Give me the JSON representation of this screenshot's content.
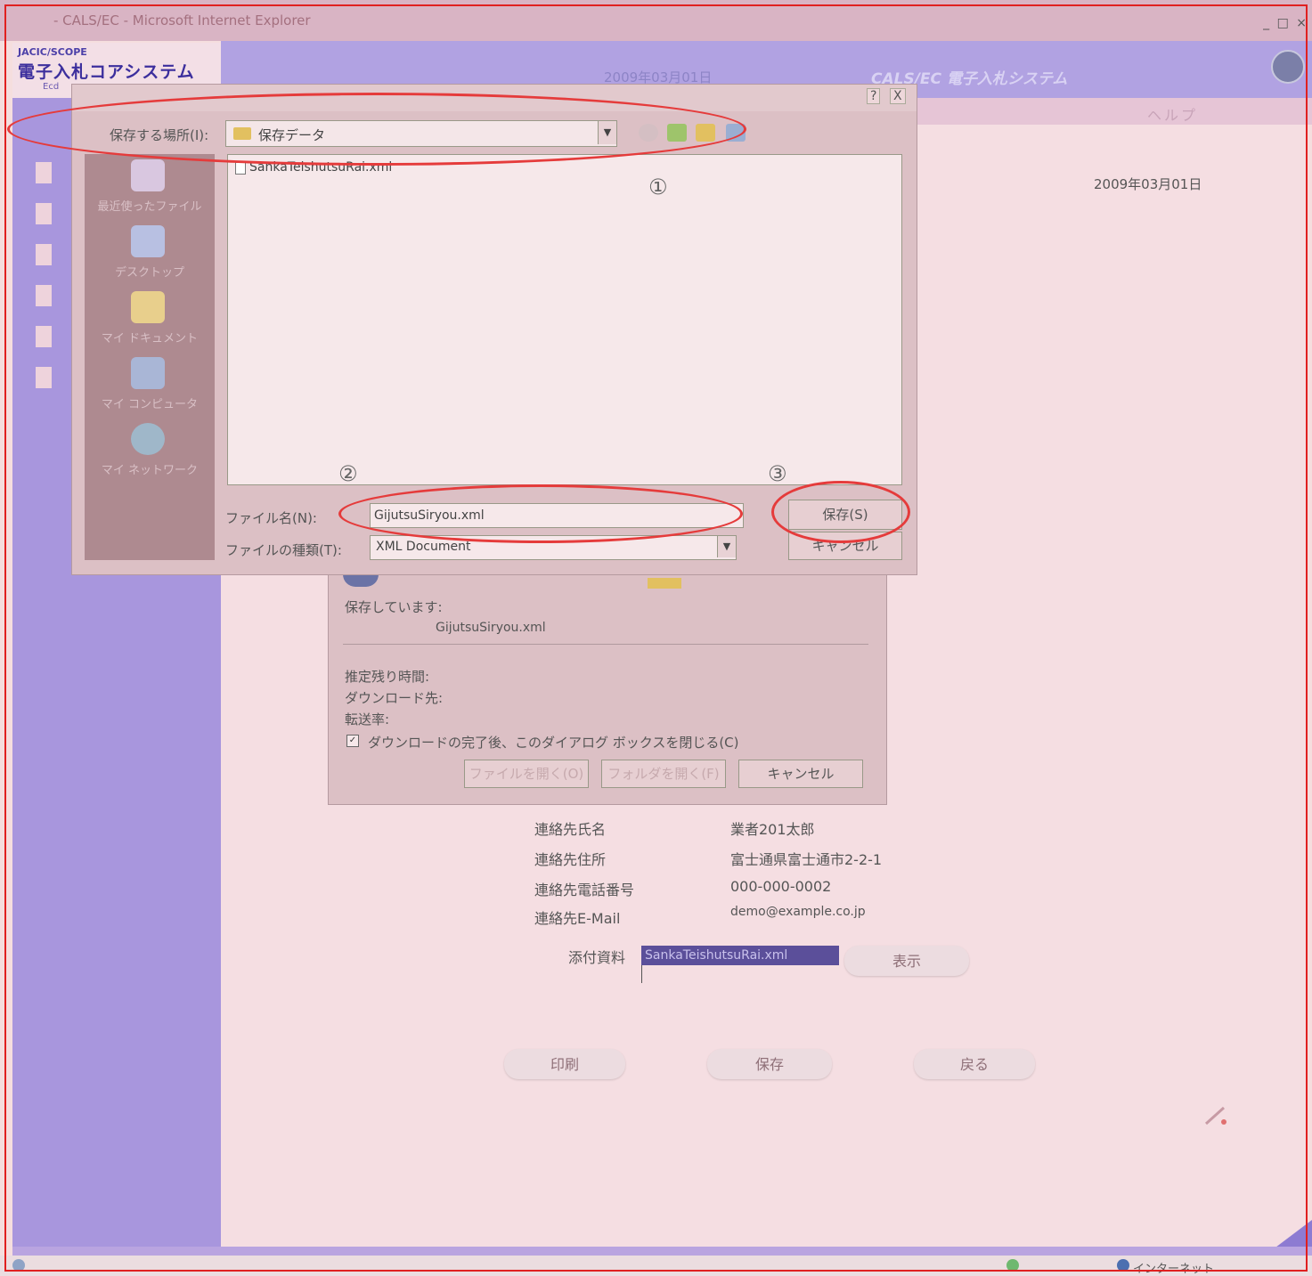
{
  "browser": {
    "title": "- CALS/EC - Microsoft Internet Explorer",
    "window_controls": "_ □ ×"
  },
  "header": {
    "logo_sub": "JACIC/SCOPE",
    "logo_main": "電子入札コアシステム",
    "logo_foot": "Ecd",
    "ghost_text": "2009年03月01日",
    "system_title": "CALS/EC 電子入札システム",
    "help": "ヘルプ"
  },
  "content": {
    "date": "2009年03月01日"
  },
  "save_dialog": {
    "help_btn": "?",
    "close_btn": "X",
    "location_label": "保存する場所(I):",
    "location_value": "保存データ",
    "places": [
      "最近使ったファイル",
      "デスクトップ",
      "マイ ドキュメント",
      "マイ コンピュータ",
      "マイ ネットワーク"
    ],
    "files": [
      "SankaTeishutsuRai.xml"
    ],
    "filename_label": "ファイル名(N):",
    "filename_value": "GijutsuSiryou.xml",
    "filetype_label": "ファイルの種類(T):",
    "filetype_value": "XML Document",
    "save_button": "保存(S)",
    "cancel_button": "キャンセル"
  },
  "annotations": {
    "step1": "①",
    "step2": "②",
    "step3": "③"
  },
  "download_dialog": {
    "saving": "保存しています:",
    "file": "GijutsuSiryou.xml",
    "remaining_label": "推定残り時間:",
    "dest_label": "ダウンロード先:",
    "rate_label": "転送率:",
    "close_checkbox": "ダウンロードの完了後、このダイアログ ボックスを閉じる(C)",
    "open_file": "ファイルを開く(O)",
    "open_folder": "フォルダを開く(F)",
    "cancel": "キャンセル"
  },
  "form": {
    "rows": [
      {
        "label": "連絡先氏名",
        "value": "業者201太郎"
      },
      {
        "label": "連絡先住所",
        "value": "富士通県富士通市2-2-1"
      },
      {
        "label": "連絡先電話番号",
        "value": "000-000-0002"
      },
      {
        "label": "連絡先E-Mail",
        "value": "demo@example.co.jp"
      }
    ],
    "attach_label": "添付資料",
    "attach_value": "SankaTeishutsuRai.xml",
    "show_button": "表示",
    "print_button": "印刷",
    "save_button": "保存",
    "back_button": "戻る"
  },
  "statusbar": {
    "zone": "インターネット"
  },
  "colors": {
    "annotation": "#e53b3b",
    "header": "#b1a2e2",
    "sidebar": "#a896dd"
  }
}
